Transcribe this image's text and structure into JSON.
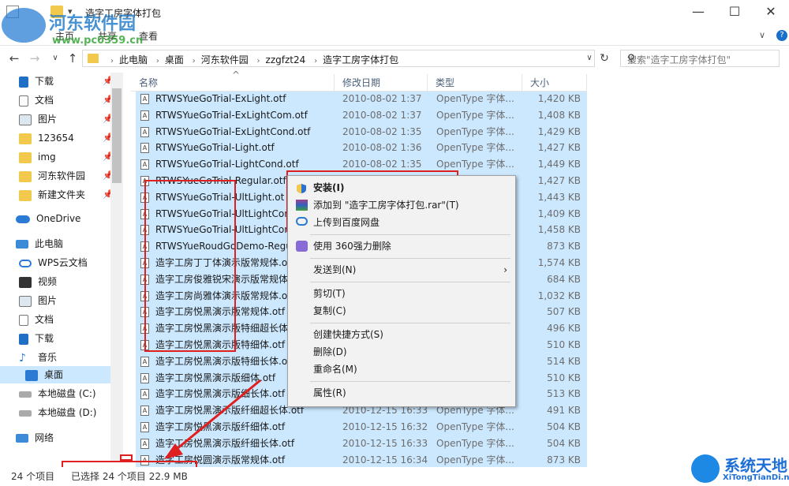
{
  "window": {
    "title": "造字工房字体打包",
    "minimize": "—",
    "maximize": "☐",
    "close": "✕"
  },
  "ribbon": {
    "tabs": [
      "主页",
      "共享",
      "查看"
    ],
    "expand": "∨",
    "help": "?"
  },
  "address": {
    "crumbs": [
      "此电脑",
      "桌面",
      "河东软件园",
      "zzgfzt24",
      "造字工房字体打包"
    ],
    "search_placeholder": "搜索\"造字工房字体打包\""
  },
  "nav": {
    "quick": [
      {
        "label": "下载",
        "icon": "download-icon"
      },
      {
        "label": "文档",
        "icon": "document-icon"
      },
      {
        "label": "图片",
        "icon": "picture-icon"
      },
      {
        "label": "123654",
        "icon": "folder-icon"
      },
      {
        "label": "img",
        "icon": "folder-icon"
      },
      {
        "label": "河东软件园",
        "icon": "folder-icon"
      },
      {
        "label": "新建文件夹",
        "icon": "folder-icon"
      }
    ],
    "onedrive": "OneDrive",
    "thispc": "此电脑",
    "pc_items": [
      {
        "label": "WPS云文档",
        "icon": "cloud-icon"
      },
      {
        "label": "视频",
        "icon": "video-icon"
      },
      {
        "label": "图片",
        "icon": "picture-icon"
      },
      {
        "label": "文档",
        "icon": "document-icon"
      },
      {
        "label": "下载",
        "icon": "download-icon"
      },
      {
        "label": "音乐",
        "icon": "music-icon"
      },
      {
        "label": "桌面",
        "icon": "desktop-icon"
      },
      {
        "label": "本地磁盘 (C:)",
        "icon": "drive-icon"
      },
      {
        "label": "本地磁盘 (D:)",
        "icon": "drive-icon"
      }
    ],
    "network": "网络"
  },
  "columns": {
    "name": "名称",
    "date": "修改日期",
    "type": "类型",
    "size": "大小"
  },
  "files": [
    {
      "name": "RTWSYueGoTrial-ExLight.otf",
      "date": "2010-08-02 1:37",
      "type": "OpenType 字体...",
      "size": "1,420 KB"
    },
    {
      "name": "RTWSYueGoTrial-ExLightCom.otf",
      "date": "2010-08-02 1:37",
      "type": "OpenType 字体...",
      "size": "1,408 KB"
    },
    {
      "name": "RTWSYueGoTrial-ExLightCond.otf",
      "date": "2010-08-02 1:35",
      "type": "OpenType 字体...",
      "size": "1,429 KB"
    },
    {
      "name": "RTWSYueGoTrial-Light.otf",
      "date": "2010-08-02 1:36",
      "type": "OpenType 字体...",
      "size": "1,427 KB"
    },
    {
      "name": "RTWSYueGoTrial-LightCond.otf",
      "date": "2010-08-02 1:35",
      "type": "OpenType 字体...",
      "size": "1,449 KB"
    },
    {
      "name": "RTWSYueGoTrial-Regular.otf",
      "date": "",
      "type": "",
      "size": "1,427 KB"
    },
    {
      "name": "RTWSYueGoTrial-UltLight.ot",
      "date": "",
      "type": "",
      "size": "1,443 KB"
    },
    {
      "name": "RTWSYueGoTrial-UltLightCon",
      "date": "",
      "type": "",
      "size": "1,409 KB"
    },
    {
      "name": "RTWSYueGoTrial-UltLightCon",
      "date": "",
      "type": "",
      "size": "1,458 KB"
    },
    {
      "name": "RTWSYueRoudGoDemo-Regu",
      "date": "",
      "type": "",
      "size": "873 KB"
    },
    {
      "name": "造字工房丁丁体演示版常规体.ot",
      "date": "",
      "type": "",
      "size": "1,574 KB"
    },
    {
      "name": "造字工房俊雅锐宋演示版常规体",
      "date": "",
      "type": "",
      "size": "684 KB"
    },
    {
      "name": "造字工房尚雅体演示版常规体.o",
      "date": "",
      "type": "",
      "size": "1,032 KB"
    },
    {
      "name": "造字工房悦黑演示版常规体.otf",
      "date": "",
      "type": "",
      "size": "507 KB"
    },
    {
      "name": "造字工房悦黑演示版特细超长体.",
      "date": "",
      "type": "",
      "size": "496 KB"
    },
    {
      "name": "造字工房悦黑演示版特细体.otf",
      "date": "",
      "type": "",
      "size": "510 KB"
    },
    {
      "name": "造字工房悦黑演示版特细长体.ot",
      "date": "",
      "type": "",
      "size": "514 KB"
    },
    {
      "name": "造字工房悦黑演示版细体.otf",
      "date": "",
      "type": "",
      "size": "510 KB"
    },
    {
      "name": "造字工房悦黑演示版细长体.otf",
      "date": "",
      "type": "",
      "size": "513 KB"
    },
    {
      "name": "造字工房悦黑演示版纤细超长体.otf",
      "date": "2010-12-15 16:33",
      "type": "OpenType 字体...",
      "size": "491 KB"
    },
    {
      "name": "造字工房悦黑演示版纤细体.otf",
      "date": "2010-12-15 16:32",
      "type": "OpenType 字体...",
      "size": "504 KB"
    },
    {
      "name": "造字工房悦黑演示版纤细长体.otf",
      "date": "2010-12-15 16:33",
      "type": "OpenType 字体...",
      "size": "504 KB"
    },
    {
      "name": "造字工房悦圆演示版常规体.otf",
      "date": "2010-12-15 16:34",
      "type": "OpenType 字体...",
      "size": "873 KB"
    }
  ],
  "context_menu": {
    "install": "安装(I)",
    "add_rar": "添加到 \"造字工房字体打包.rar\"(T)",
    "upload_baidu": "上传到百度网盘",
    "delete_360": "使用 360强力删除",
    "send_to": "发送到(N)",
    "cut": "剪切(T)",
    "copy": "复制(C)",
    "shortcut": "创建快捷方式(S)",
    "delete": "删除(D)",
    "rename": "重命名(M)",
    "properties": "属性(R)"
  },
  "status": {
    "count": "24 个项目",
    "selected": "已选择 24 个项目  22.9 MB"
  },
  "watermarks": {
    "site_name": "河东软件园",
    "site_url": "www.pc0359.cn",
    "brand_name": "系统天地",
    "brand_url": "XiTongTianDi.net"
  },
  "colors": {
    "selection": "#cce8ff",
    "annotation_red": "#e02020",
    "accent": "#0078d7"
  }
}
